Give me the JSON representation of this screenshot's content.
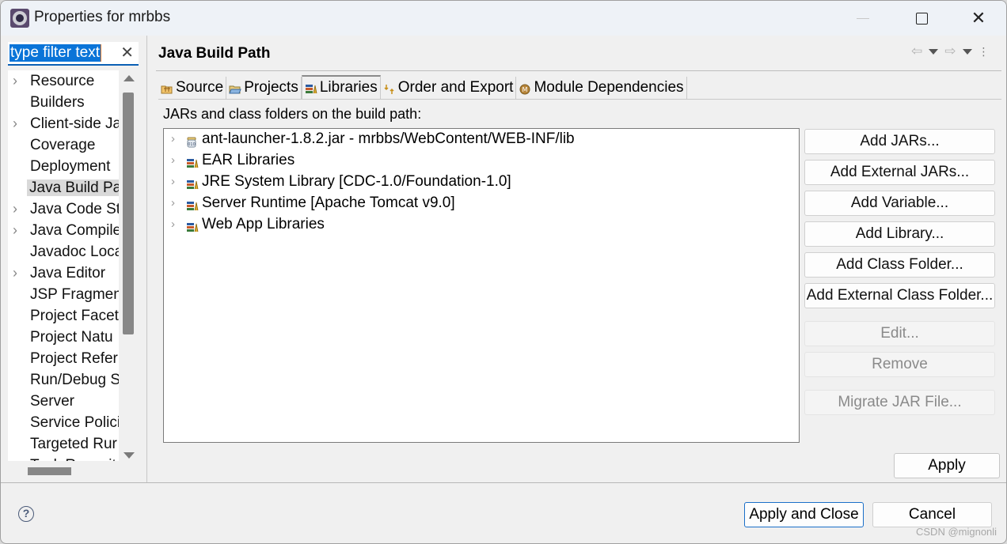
{
  "window": {
    "title": "Properties for mrbbs",
    "controls": {
      "minimize": "—",
      "maximize": "□",
      "close": "✕"
    }
  },
  "filter": {
    "value": "type filter text",
    "clear_icon": "✕"
  },
  "sidebar": {
    "items": [
      {
        "label": "Resource",
        "expandable": true,
        "selected": false
      },
      {
        "label": "Builders",
        "expandable": false,
        "selected": false
      },
      {
        "label": "Client-side Ja",
        "expandable": true,
        "selected": false
      },
      {
        "label": "Coverage",
        "expandable": false,
        "selected": false
      },
      {
        "label": "Deployment",
        "expandable": false,
        "selected": false
      },
      {
        "label": "Java Build Pa",
        "expandable": false,
        "selected": true
      },
      {
        "label": "Java Code Sty",
        "expandable": true,
        "selected": false
      },
      {
        "label": "Java Compile",
        "expandable": true,
        "selected": false
      },
      {
        "label": "Javadoc Loca",
        "expandable": false,
        "selected": false
      },
      {
        "label": "Java Editor",
        "expandable": true,
        "selected": false
      },
      {
        "label": "JSP Fragmen",
        "expandable": false,
        "selected": false
      },
      {
        "label": "Project Facet",
        "expandable": false,
        "selected": false
      },
      {
        "label": "Project Natu",
        "expandable": false,
        "selected": false
      },
      {
        "label": "Project Refer",
        "expandable": false,
        "selected": false
      },
      {
        "label": "Run/Debug S",
        "expandable": false,
        "selected": false
      },
      {
        "label": "Server",
        "expandable": false,
        "selected": false
      },
      {
        "label": "Service Polici",
        "expandable": false,
        "selected": false
      },
      {
        "label": "Targeted Rur",
        "expandable": false,
        "selected": false
      },
      {
        "label": "Task Reposit",
        "expandable": true,
        "selected": false
      }
    ]
  },
  "page": {
    "title": "Java Build Path",
    "nav": {
      "back_icon": "⇦",
      "forward_icon": "⇨",
      "menu_icon": "⋮"
    },
    "tabs": [
      {
        "label": "Source",
        "icon": "source-folder",
        "active": false
      },
      {
        "label": "Projects",
        "icon": "project-folder",
        "active": false
      },
      {
        "label": "Libraries",
        "icon": "library",
        "active": true
      },
      {
        "label": "Order and Export",
        "icon": "order-export",
        "active": false
      },
      {
        "label": "Module Dependencies",
        "icon": "module",
        "active": false
      }
    ],
    "section_label": "JARs and class folders on the build path:",
    "libraries": [
      {
        "label": "ant-launcher-1.8.2.jar - mrbbs/WebContent/WEB-INF/lib",
        "icon": "jar"
      },
      {
        "label": "EAR Libraries",
        "icon": "library"
      },
      {
        "label": "JRE System Library [CDC-1.0/Foundation-1.0]",
        "icon": "library"
      },
      {
        "label": "Server Runtime [Apache Tomcat v9.0]",
        "icon": "library"
      },
      {
        "label": "Web App Libraries",
        "icon": "library"
      }
    ],
    "buttons": [
      {
        "label": "Add JARs...",
        "enabled": true
      },
      {
        "label": "Add External JARs...",
        "enabled": true
      },
      {
        "label": "Add Variable...",
        "enabled": true
      },
      {
        "label": "Add Library...",
        "enabled": true
      },
      {
        "label": "Add Class Folder...",
        "enabled": true
      },
      {
        "label": "Add External Class Folder...",
        "enabled": true
      },
      {
        "label": "Edit...",
        "enabled": false
      },
      {
        "label": "Remove",
        "enabled": false
      },
      {
        "label": "Migrate JAR File...",
        "enabled": false
      }
    ],
    "apply_label": "Apply"
  },
  "footer": {
    "help_icon": "?",
    "apply_close_label": "Apply and Close",
    "cancel_label": "Cancel",
    "watermark": "CSDN @mignonli"
  },
  "colors": {
    "selection": "#0a74d8",
    "focus_border": "#1a6fc8",
    "disabled_text": "#8a8a8a"
  }
}
